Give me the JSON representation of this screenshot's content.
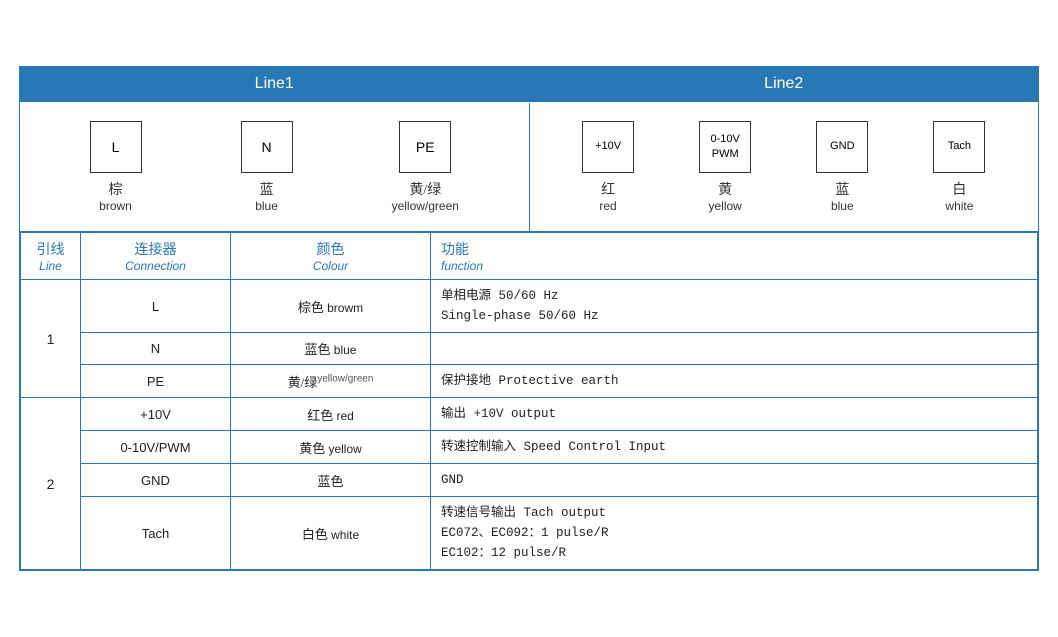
{
  "header": {
    "line1_label": "Line1",
    "line2_label": "Line2"
  },
  "line1_connectors": [
    {
      "symbol": "L",
      "zh": "棕",
      "en": "brown"
    },
    {
      "symbol": "N",
      "zh": "蓝",
      "en": "blue"
    },
    {
      "symbol": "PE",
      "zh": "黄/绿",
      "en": "yellow/green"
    }
  ],
  "line2_connectors": [
    {
      "symbol": "+10V",
      "zh": "红",
      "en": "red"
    },
    {
      "symbol": "0-10V\nPWM",
      "zh": "黄",
      "en": "yellow"
    },
    {
      "symbol": "GND",
      "zh": "蓝",
      "en": "blue"
    },
    {
      "symbol": "Tach",
      "zh": "白",
      "en": "white"
    }
  ],
  "table_headers": {
    "line_zh": "引线",
    "line_en": "Line",
    "conn_zh": "连接器",
    "conn_en": "Connection",
    "colour_zh": "颜色",
    "colour_en": "Colour",
    "func_zh": "功能",
    "func_en": "function"
  },
  "rows": [
    {
      "line": "1",
      "line_rowspan": 3,
      "connection": "L",
      "colour_zh": "棕色",
      "colour_en": "browm",
      "func": "单相电源 50/60 Hz\nSingle-phase 50/60 Hz",
      "func_rows": [
        "单相电源 50/60 Hz",
        "Single-phase 50/60 Hz"
      ]
    },
    {
      "connection": "N",
      "colour_zh": "蓝色",
      "colour_en": "blue",
      "func_rows": []
    },
    {
      "connection": "PE",
      "colour_zh": "黄/绿",
      "colour_en_super": "yellow/green",
      "func_rows": [
        "保护接地 Protective earth"
      ]
    },
    {
      "line": "2",
      "line_rowspan": 4,
      "connection": "+10V",
      "colour_zh": "红色",
      "colour_en": "red",
      "func_rows": [
        "输出 +10V output"
      ]
    },
    {
      "connection": "0-10V/PWM",
      "colour_zh": "黄色",
      "colour_en": "yellow",
      "func_rows": [
        "转速控制输入 Speed Control Input"
      ]
    },
    {
      "connection": "GND",
      "colour_zh": "蓝色",
      "colour_en": "",
      "func_rows": [
        "GND"
      ]
    },
    {
      "connection": "Tach",
      "colour_zh": "白色",
      "colour_en": "white",
      "func_rows": [
        "转速信号输出 Tach output",
        "EC072、EC092：1 pulse/R",
        "EC102：12 pulse/R"
      ]
    }
  ]
}
